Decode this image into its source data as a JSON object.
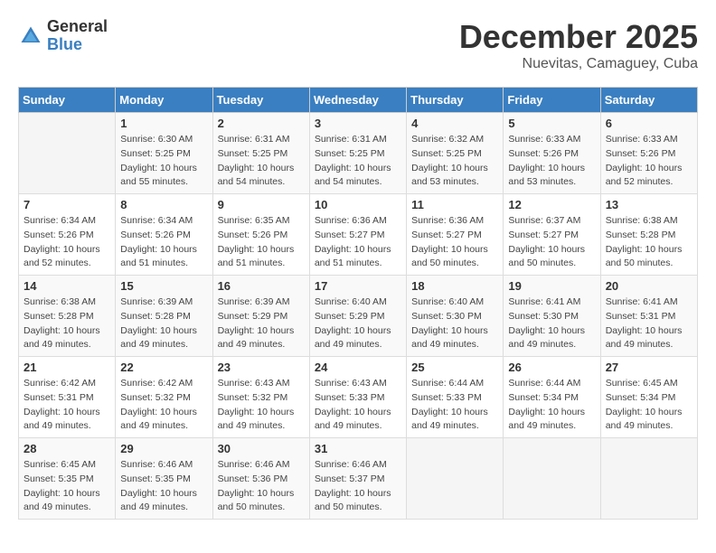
{
  "header": {
    "logo_general": "General",
    "logo_blue": "Blue",
    "month": "December 2025",
    "location": "Nuevitas, Camaguey, Cuba"
  },
  "days_of_week": [
    "Sunday",
    "Monday",
    "Tuesday",
    "Wednesday",
    "Thursday",
    "Friday",
    "Saturday"
  ],
  "weeks": [
    [
      {
        "day": "",
        "sunrise": "",
        "sunset": "",
        "daylight": ""
      },
      {
        "day": "1",
        "sunrise": "Sunrise: 6:30 AM",
        "sunset": "Sunset: 5:25 PM",
        "daylight": "Daylight: 10 hours and 55 minutes."
      },
      {
        "day": "2",
        "sunrise": "Sunrise: 6:31 AM",
        "sunset": "Sunset: 5:25 PM",
        "daylight": "Daylight: 10 hours and 54 minutes."
      },
      {
        "day": "3",
        "sunrise": "Sunrise: 6:31 AM",
        "sunset": "Sunset: 5:25 PM",
        "daylight": "Daylight: 10 hours and 54 minutes."
      },
      {
        "day": "4",
        "sunrise": "Sunrise: 6:32 AM",
        "sunset": "Sunset: 5:25 PM",
        "daylight": "Daylight: 10 hours and 53 minutes."
      },
      {
        "day": "5",
        "sunrise": "Sunrise: 6:33 AM",
        "sunset": "Sunset: 5:26 PM",
        "daylight": "Daylight: 10 hours and 53 minutes."
      },
      {
        "day": "6",
        "sunrise": "Sunrise: 6:33 AM",
        "sunset": "Sunset: 5:26 PM",
        "daylight": "Daylight: 10 hours and 52 minutes."
      }
    ],
    [
      {
        "day": "7",
        "sunrise": "Sunrise: 6:34 AM",
        "sunset": "Sunset: 5:26 PM",
        "daylight": "Daylight: 10 hours and 52 minutes."
      },
      {
        "day": "8",
        "sunrise": "Sunrise: 6:34 AM",
        "sunset": "Sunset: 5:26 PM",
        "daylight": "Daylight: 10 hours and 51 minutes."
      },
      {
        "day": "9",
        "sunrise": "Sunrise: 6:35 AM",
        "sunset": "Sunset: 5:26 PM",
        "daylight": "Daylight: 10 hours and 51 minutes."
      },
      {
        "day": "10",
        "sunrise": "Sunrise: 6:36 AM",
        "sunset": "Sunset: 5:27 PM",
        "daylight": "Daylight: 10 hours and 51 minutes."
      },
      {
        "day": "11",
        "sunrise": "Sunrise: 6:36 AM",
        "sunset": "Sunset: 5:27 PM",
        "daylight": "Daylight: 10 hours and 50 minutes."
      },
      {
        "day": "12",
        "sunrise": "Sunrise: 6:37 AM",
        "sunset": "Sunset: 5:27 PM",
        "daylight": "Daylight: 10 hours and 50 minutes."
      },
      {
        "day": "13",
        "sunrise": "Sunrise: 6:38 AM",
        "sunset": "Sunset: 5:28 PM",
        "daylight": "Daylight: 10 hours and 50 minutes."
      }
    ],
    [
      {
        "day": "14",
        "sunrise": "Sunrise: 6:38 AM",
        "sunset": "Sunset: 5:28 PM",
        "daylight": "Daylight: 10 hours and 49 minutes."
      },
      {
        "day": "15",
        "sunrise": "Sunrise: 6:39 AM",
        "sunset": "Sunset: 5:28 PM",
        "daylight": "Daylight: 10 hours and 49 minutes."
      },
      {
        "day": "16",
        "sunrise": "Sunrise: 6:39 AM",
        "sunset": "Sunset: 5:29 PM",
        "daylight": "Daylight: 10 hours and 49 minutes."
      },
      {
        "day": "17",
        "sunrise": "Sunrise: 6:40 AM",
        "sunset": "Sunset: 5:29 PM",
        "daylight": "Daylight: 10 hours and 49 minutes."
      },
      {
        "day": "18",
        "sunrise": "Sunrise: 6:40 AM",
        "sunset": "Sunset: 5:30 PM",
        "daylight": "Daylight: 10 hours and 49 minutes."
      },
      {
        "day": "19",
        "sunrise": "Sunrise: 6:41 AM",
        "sunset": "Sunset: 5:30 PM",
        "daylight": "Daylight: 10 hours and 49 minutes."
      },
      {
        "day": "20",
        "sunrise": "Sunrise: 6:41 AM",
        "sunset": "Sunset: 5:31 PM",
        "daylight": "Daylight: 10 hours and 49 minutes."
      }
    ],
    [
      {
        "day": "21",
        "sunrise": "Sunrise: 6:42 AM",
        "sunset": "Sunset: 5:31 PM",
        "daylight": "Daylight: 10 hours and 49 minutes."
      },
      {
        "day": "22",
        "sunrise": "Sunrise: 6:42 AM",
        "sunset": "Sunset: 5:32 PM",
        "daylight": "Daylight: 10 hours and 49 minutes."
      },
      {
        "day": "23",
        "sunrise": "Sunrise: 6:43 AM",
        "sunset": "Sunset: 5:32 PM",
        "daylight": "Daylight: 10 hours and 49 minutes."
      },
      {
        "day": "24",
        "sunrise": "Sunrise: 6:43 AM",
        "sunset": "Sunset: 5:33 PM",
        "daylight": "Daylight: 10 hours and 49 minutes."
      },
      {
        "day": "25",
        "sunrise": "Sunrise: 6:44 AM",
        "sunset": "Sunset: 5:33 PM",
        "daylight": "Daylight: 10 hours and 49 minutes."
      },
      {
        "day": "26",
        "sunrise": "Sunrise: 6:44 AM",
        "sunset": "Sunset: 5:34 PM",
        "daylight": "Daylight: 10 hours and 49 minutes."
      },
      {
        "day": "27",
        "sunrise": "Sunrise: 6:45 AM",
        "sunset": "Sunset: 5:34 PM",
        "daylight": "Daylight: 10 hours and 49 minutes."
      }
    ],
    [
      {
        "day": "28",
        "sunrise": "Sunrise: 6:45 AM",
        "sunset": "Sunset: 5:35 PM",
        "daylight": "Daylight: 10 hours and 49 minutes."
      },
      {
        "day": "29",
        "sunrise": "Sunrise: 6:46 AM",
        "sunset": "Sunset: 5:35 PM",
        "daylight": "Daylight: 10 hours and 49 minutes."
      },
      {
        "day": "30",
        "sunrise": "Sunrise: 6:46 AM",
        "sunset": "Sunset: 5:36 PM",
        "daylight": "Daylight: 10 hours and 50 minutes."
      },
      {
        "day": "31",
        "sunrise": "Sunrise: 6:46 AM",
        "sunset": "Sunset: 5:37 PM",
        "daylight": "Daylight: 10 hours and 50 minutes."
      },
      {
        "day": "",
        "sunrise": "",
        "sunset": "",
        "daylight": ""
      },
      {
        "day": "",
        "sunrise": "",
        "sunset": "",
        "daylight": ""
      },
      {
        "day": "",
        "sunrise": "",
        "sunset": "",
        "daylight": ""
      }
    ]
  ]
}
